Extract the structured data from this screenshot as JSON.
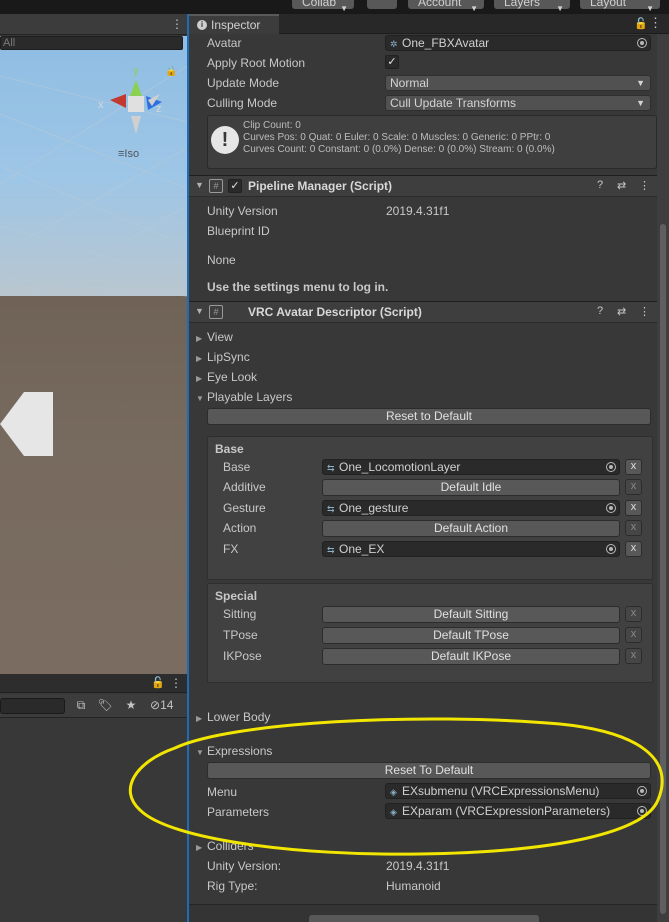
{
  "toolbar": {
    "collab_label": "Collab",
    "account_label": "Account",
    "layers_label": "Layers",
    "layout_label": "Layout"
  },
  "scene": {
    "search_placeholder": "All",
    "gizmo_x": "x",
    "gizmo_y": "y",
    "gizmo_z": "z",
    "projection_label": "Iso"
  },
  "project_panel": {
    "hidden_count": "14"
  },
  "inspector": {
    "tab_label": "Inspector",
    "animator": {
      "avatar_label": "Avatar",
      "avatar_value": "One_FBXAvatar",
      "apply_root_motion_label": "Apply Root Motion",
      "apply_root_motion_checked": "✓",
      "update_mode_label": "Update Mode",
      "update_mode_value": "Normal",
      "culling_mode_label": "Culling Mode",
      "culling_mode_value": "Cull Update Transforms",
      "info_lines": [
        "Clip Count: 0",
        "Curves Pos: 0 Quat: 0 Euler: 0 Scale: 0 Muscles: 0 Generic: 0 PPtr: 0",
        "Curves Count: 0 Constant: 0 (0.0%) Dense: 0 (0.0%) Stream: 0 (0.0%)"
      ]
    },
    "pipeline": {
      "title": "Pipeline Manager (Script)",
      "unity_version_label": "Unity Version",
      "unity_version_value": "2019.4.31f1",
      "blueprint_id_label": "Blueprint ID",
      "none_text": "None",
      "login_text": "Use the settings menu to log in."
    },
    "descriptor": {
      "title": "VRC Avatar Descriptor (Script)",
      "foldouts": {
        "view": "View",
        "lipsync": "LipSync",
        "eye_look": "Eye Look",
        "playable_layers": "Playable Layers",
        "lower_body": "Lower Body",
        "expressions": "Expressions",
        "colliders": "Colliders"
      },
      "reset_to_default_label": "Reset to Default",
      "base_group": {
        "title": "Base",
        "rows": [
          {
            "label": "Base",
            "value": "One_LocomotionLayer",
            "x": "x"
          },
          {
            "label": "Additive",
            "value": "Default Idle",
            "x": "x"
          },
          {
            "label": "Gesture",
            "value": "One_gesture",
            "x": "x"
          },
          {
            "label": "Action",
            "value": "Default Action",
            "x": "x"
          },
          {
            "label": "FX",
            "value": "One_EX",
            "x": "x"
          }
        ]
      },
      "special_group": {
        "title": "Special",
        "rows": [
          {
            "label": "Sitting",
            "value": "Default Sitting",
            "x": "x"
          },
          {
            "label": "TPose",
            "value": "Default TPose",
            "x": "x"
          },
          {
            "label": "IKPose",
            "value": "Default IKPose",
            "x": "x"
          }
        ]
      },
      "expressions": {
        "reset_label": "Reset To Default",
        "menu_label": "Menu",
        "menu_value": "EXsubmenu (VRCExpressionsMenu)",
        "parameters_label": "Parameters",
        "parameters_value": "EXparam (VRCExpressionParameters)"
      },
      "unity_version_label": "Unity Version:",
      "unity_version_value": "2019.4.31f1",
      "rig_type_label": "Rig Type:",
      "rig_type_value": "Humanoid"
    }
  },
  "annotation": {
    "highlight_color": "#f2e600"
  }
}
